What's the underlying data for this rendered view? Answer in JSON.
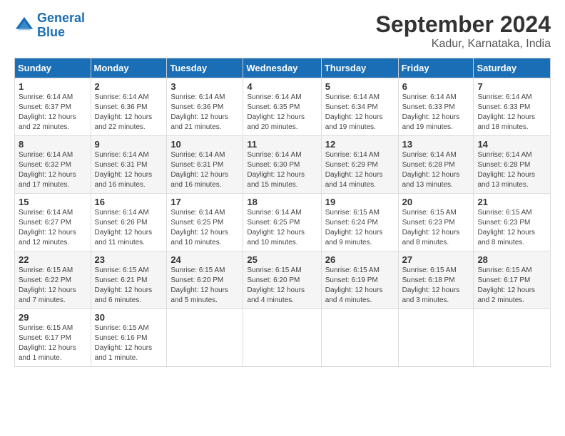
{
  "header": {
    "logo_line1": "General",
    "logo_line2": "Blue",
    "month_year": "September 2024",
    "location": "Kadur, Karnataka, India"
  },
  "days_of_week": [
    "Sunday",
    "Monday",
    "Tuesday",
    "Wednesday",
    "Thursday",
    "Friday",
    "Saturday"
  ],
  "weeks": [
    [
      {
        "day": "1",
        "sunrise": "6:14 AM",
        "sunset": "6:37 PM",
        "daylight": "12 hours and 22 minutes."
      },
      {
        "day": "2",
        "sunrise": "6:14 AM",
        "sunset": "6:36 PM",
        "daylight": "12 hours and 22 minutes."
      },
      {
        "day": "3",
        "sunrise": "6:14 AM",
        "sunset": "6:36 PM",
        "daylight": "12 hours and 21 minutes."
      },
      {
        "day": "4",
        "sunrise": "6:14 AM",
        "sunset": "6:35 PM",
        "daylight": "12 hours and 20 minutes."
      },
      {
        "day": "5",
        "sunrise": "6:14 AM",
        "sunset": "6:34 PM",
        "daylight": "12 hours and 19 minutes."
      },
      {
        "day": "6",
        "sunrise": "6:14 AM",
        "sunset": "6:33 PM",
        "daylight": "12 hours and 19 minutes."
      },
      {
        "day": "7",
        "sunrise": "6:14 AM",
        "sunset": "6:33 PM",
        "daylight": "12 hours and 18 minutes."
      }
    ],
    [
      {
        "day": "8",
        "sunrise": "6:14 AM",
        "sunset": "6:32 PM",
        "daylight": "12 hours and 17 minutes."
      },
      {
        "day": "9",
        "sunrise": "6:14 AM",
        "sunset": "6:31 PM",
        "daylight": "12 hours and 16 minutes."
      },
      {
        "day": "10",
        "sunrise": "6:14 AM",
        "sunset": "6:31 PM",
        "daylight": "12 hours and 16 minutes."
      },
      {
        "day": "11",
        "sunrise": "6:14 AM",
        "sunset": "6:30 PM",
        "daylight": "12 hours and 15 minutes."
      },
      {
        "day": "12",
        "sunrise": "6:14 AM",
        "sunset": "6:29 PM",
        "daylight": "12 hours and 14 minutes."
      },
      {
        "day": "13",
        "sunrise": "6:14 AM",
        "sunset": "6:28 PM",
        "daylight": "12 hours and 13 minutes."
      },
      {
        "day": "14",
        "sunrise": "6:14 AM",
        "sunset": "6:28 PM",
        "daylight": "12 hours and 13 minutes."
      }
    ],
    [
      {
        "day": "15",
        "sunrise": "6:14 AM",
        "sunset": "6:27 PM",
        "daylight": "12 hours and 12 minutes."
      },
      {
        "day": "16",
        "sunrise": "6:14 AM",
        "sunset": "6:26 PM",
        "daylight": "12 hours and 11 minutes."
      },
      {
        "day": "17",
        "sunrise": "6:14 AM",
        "sunset": "6:25 PM",
        "daylight": "12 hours and 10 minutes."
      },
      {
        "day": "18",
        "sunrise": "6:14 AM",
        "sunset": "6:25 PM",
        "daylight": "12 hours and 10 minutes."
      },
      {
        "day": "19",
        "sunrise": "6:15 AM",
        "sunset": "6:24 PM",
        "daylight": "12 hours and 9 minutes."
      },
      {
        "day": "20",
        "sunrise": "6:15 AM",
        "sunset": "6:23 PM",
        "daylight": "12 hours and 8 minutes."
      },
      {
        "day": "21",
        "sunrise": "6:15 AM",
        "sunset": "6:23 PM",
        "daylight": "12 hours and 8 minutes."
      }
    ],
    [
      {
        "day": "22",
        "sunrise": "6:15 AM",
        "sunset": "6:22 PM",
        "daylight": "12 hours and 7 minutes."
      },
      {
        "day": "23",
        "sunrise": "6:15 AM",
        "sunset": "6:21 PM",
        "daylight": "12 hours and 6 minutes."
      },
      {
        "day": "24",
        "sunrise": "6:15 AM",
        "sunset": "6:20 PM",
        "daylight": "12 hours and 5 minutes."
      },
      {
        "day": "25",
        "sunrise": "6:15 AM",
        "sunset": "6:20 PM",
        "daylight": "12 hours and 4 minutes."
      },
      {
        "day": "26",
        "sunrise": "6:15 AM",
        "sunset": "6:19 PM",
        "daylight": "12 hours and 4 minutes."
      },
      {
        "day": "27",
        "sunrise": "6:15 AM",
        "sunset": "6:18 PM",
        "daylight": "12 hours and 3 minutes."
      },
      {
        "day": "28",
        "sunrise": "6:15 AM",
        "sunset": "6:17 PM",
        "daylight": "12 hours and 2 minutes."
      }
    ],
    [
      {
        "day": "29",
        "sunrise": "6:15 AM",
        "sunset": "6:17 PM",
        "daylight": "12 hours and 1 minute."
      },
      {
        "day": "30",
        "sunrise": "6:15 AM",
        "sunset": "6:16 PM",
        "daylight": "12 hours and 1 minute."
      },
      null,
      null,
      null,
      null,
      null
    ]
  ]
}
